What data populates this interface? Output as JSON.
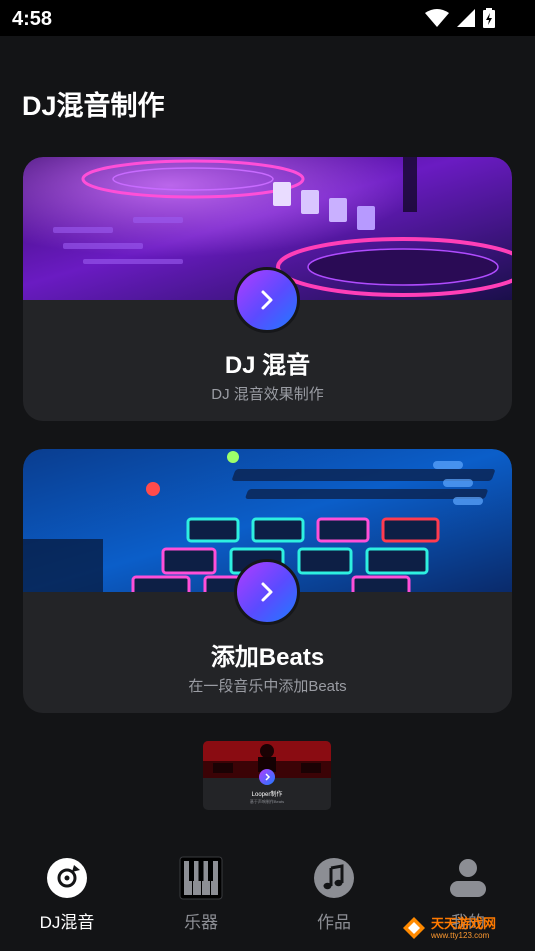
{
  "status_bar": {
    "time": "4:58"
  },
  "page": {
    "title": "DJ混音制作"
  },
  "cards": [
    {
      "title": "DJ 混音",
      "subtitle": "DJ 混音效果制作"
    },
    {
      "title": "添加Beats",
      "subtitle": "在一段音乐中添加Beats"
    }
  ],
  "mini_card": {
    "title": "Looper制作",
    "subtitle": "基于声响制作Beats"
  },
  "tabs": [
    {
      "label": "DJ混音",
      "icon": "disc-icon",
      "active": true
    },
    {
      "label": "乐器",
      "icon": "piano-icon",
      "active": false
    },
    {
      "label": "作品",
      "icon": "music-note-icon",
      "active": false
    },
    {
      "label": "我的",
      "icon": "user-icon",
      "active": false
    }
  ],
  "watermark": {
    "text": "天天游戏网",
    "url": "www.tty123.com"
  },
  "colors": {
    "background": "#131416",
    "card": "#232427",
    "accent_start": "#b13cff",
    "accent_end": "#1f7bff"
  }
}
